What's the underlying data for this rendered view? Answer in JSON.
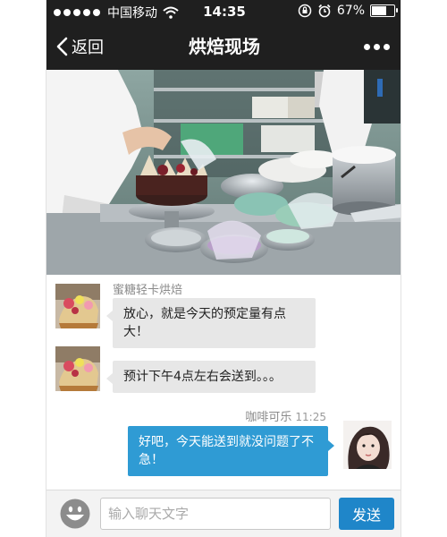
{
  "status_bar": {
    "carrier": "中国移动",
    "time": "14:35",
    "battery_percent_text": "67%",
    "battery_level": 0.67,
    "icons": [
      "signal-dots-icon",
      "wifi-icon",
      "rotation-lock-icon",
      "alarm-icon",
      "battery-icon"
    ]
  },
  "nav": {
    "back_label": "返回",
    "title": "烘焙现场",
    "more_icon": "more-dots-icon"
  },
  "photo": {
    "subject": "bakery-kitchen-cake-decorating"
  },
  "messages": [
    {
      "side": "left",
      "sender": "蜜糖轻卡烘焙",
      "text": "放心，就是今天的预定量有点大！"
    },
    {
      "side": "left",
      "sender": "",
      "text": "预计下午4点左右会送到。。。"
    },
    {
      "side": "right",
      "sender": "咖啡可乐",
      "time": "11:25",
      "text": "好吧，今天能送到就没问题了不急！"
    }
  ],
  "input": {
    "placeholder": "输入聊天文字",
    "value": "",
    "send_label": "发送",
    "emoji_icon": "smiley-face-icon"
  },
  "colors": {
    "bar_bg": "#1f1f1f",
    "my_bubble": "#2f9bd4",
    "their_bubble": "#e7e7e7",
    "send_button": "#1f86c9"
  }
}
